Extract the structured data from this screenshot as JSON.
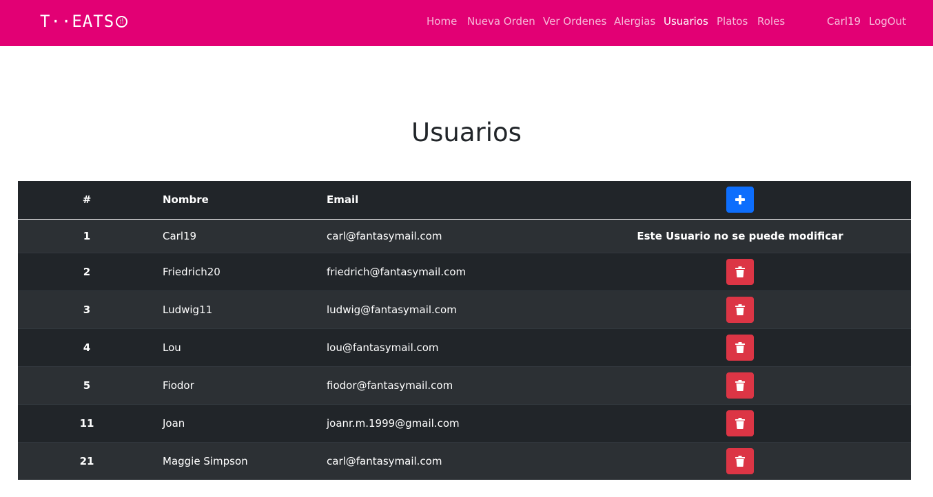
{
  "brand": {
    "logo_text": "T··EATS",
    "logo_mark": "🍴",
    "color": "#e20074"
  },
  "nav": {
    "items": [
      {
        "label": "Home"
      },
      {
        "label": "Nueva Orden"
      },
      {
        "label": "Ver Ordenes"
      },
      {
        "label": "Alergias"
      },
      {
        "label": "Usuarios",
        "active": true
      },
      {
        "label": "Platos"
      },
      {
        "label": "Roles"
      }
    ],
    "user": "Carl19",
    "logout": "LogOut"
  },
  "page": {
    "title": "Usuarios"
  },
  "table": {
    "headers": [
      "#",
      "Nombre",
      "Email"
    ],
    "add_icon": "plus-icon",
    "delete_icon": "trash-icon",
    "locked_text": "Este Usuario no se puede modificar",
    "rows": [
      {
        "id": "1",
        "name": "Carl19",
        "email": "carl@fantasymail.com",
        "locked": true
      },
      {
        "id": "2",
        "name": "Friedrich20",
        "email": "friedrich@fantasymail.com"
      },
      {
        "id": "3",
        "name": "Ludwig11",
        "email": "ludwig@fantasymail.com"
      },
      {
        "id": "4",
        "name": "Lou",
        "email": "lou@fantasymail.com"
      },
      {
        "id": "5",
        "name": "Fiodor",
        "email": "fiodor@fantasymail.com"
      },
      {
        "id": "11",
        "name": "Joan",
        "email": "joanr.m.1999@gmail.com"
      },
      {
        "id": "21",
        "name": "Maggie Simpson",
        "email": "carl@fantasymail.com"
      }
    ]
  },
  "colors": {
    "add_button": "#0d6efd",
    "delete_button": "#dc3545",
    "table_dark": "#212529"
  }
}
